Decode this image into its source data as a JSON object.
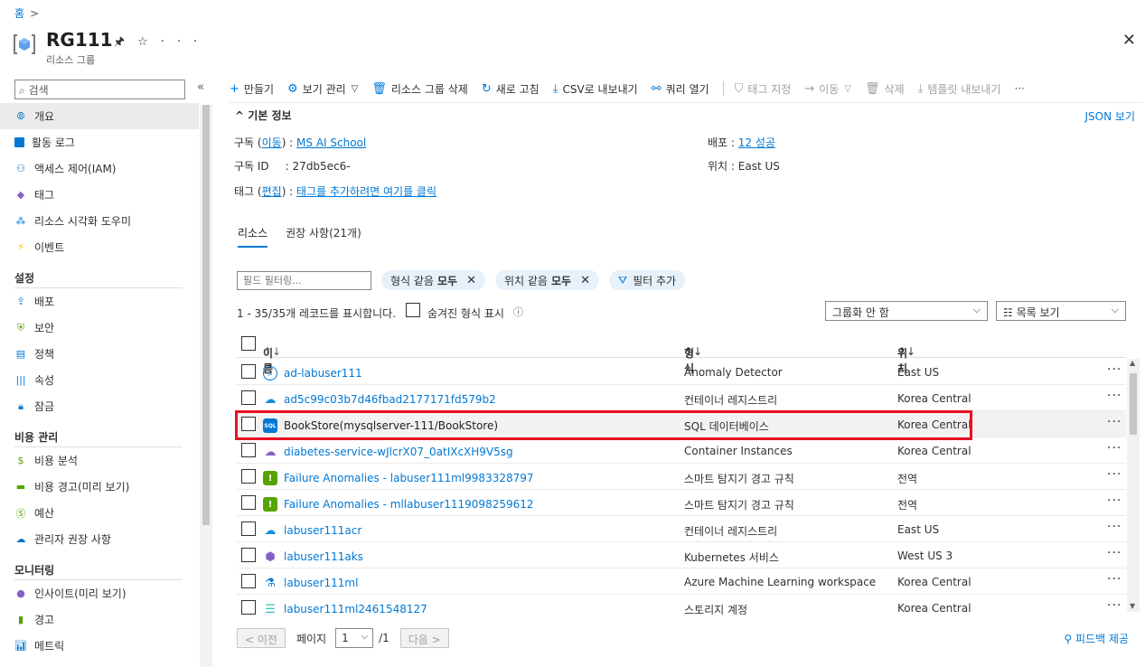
{
  "breadcrumb": {
    "home": "홈"
  },
  "header": {
    "title": "RG111",
    "subtitle": "리소스 그룹"
  },
  "sidebar": {
    "search_placeholder": "검색",
    "items": [
      {
        "label": "개요",
        "icon": "overview-icon"
      },
      {
        "label": "활동 로그",
        "icon": "log-icon"
      },
      {
        "label": "액세스 제어(IAM)",
        "icon": "people-icon"
      },
      {
        "label": "태그",
        "icon": "tag-icon"
      },
      {
        "label": "리소스 시각화 도우미",
        "icon": "visualizer-icon"
      },
      {
        "label": "이벤트",
        "icon": "lightning-icon"
      }
    ],
    "section_settings": "설정",
    "settings_items": [
      {
        "label": "배포",
        "icon": "deploy-icon"
      },
      {
        "label": "보안",
        "icon": "shield-icon"
      },
      {
        "label": "정책",
        "icon": "policy-icon"
      },
      {
        "label": "속성",
        "icon": "properties-icon"
      },
      {
        "label": "잠금",
        "icon": "lock-icon"
      }
    ],
    "section_cost": "비용 관리",
    "cost_items": [
      {
        "label": "비용 분석",
        "icon": "cost-analysis-icon"
      },
      {
        "label": "비용 경고(미리 보기)",
        "icon": "cost-alert-icon"
      },
      {
        "label": "예산",
        "icon": "budget-icon"
      },
      {
        "label": "관리자 권장 사항",
        "icon": "advisor-icon"
      }
    ],
    "section_monitoring": "모니터링",
    "monitoring_items": [
      {
        "label": "인사이트(미리 보기)",
        "icon": "insights-icon"
      },
      {
        "label": "경고",
        "icon": "alerts-icon"
      },
      {
        "label": "메트릭",
        "icon": "metrics-icon"
      }
    ]
  },
  "toolbar": {
    "create": "만들기",
    "manage_view": "보기 관리",
    "delete_rg": "리소스 그룹 삭제",
    "refresh": "새로 고침",
    "export_csv": "CSV로 내보내기",
    "open_query": "쿼리 열기",
    "assign_tags": "태그 지정",
    "move": "이동",
    "delete": "삭제",
    "export_template": "템플릿 내보내기"
  },
  "essentials": {
    "header": "기본 정보",
    "json_view": "JSON 보기",
    "subscription_label": "구독",
    "subscription_move": "이동",
    "subscription_value": "MS AI School",
    "subscription_id_label": "구독 ID",
    "subscription_id_value": "27db5ec6-",
    "tags_label": "태그",
    "tags_edit": "편집",
    "tags_value": "태그를 추가하려면 여기를 클릭",
    "deployments_label": "배포",
    "deployments_value": "12 성공",
    "location_label": "위치",
    "location_value": "East US"
  },
  "tabs": {
    "resources": "리소스",
    "recommendations": "권장 사항(21개)"
  },
  "filters": {
    "placeholder": "필드 필터링...",
    "type_prefix": "형식 같음",
    "type_value": "모두",
    "location_prefix": "위치 같음",
    "location_value": "모두",
    "add_filter": "필터 추가"
  },
  "records": {
    "summary": "1 - 35/35개 레코드를 표시합니다.",
    "show_hidden": "숨겨진 형식 표시",
    "grouping": "그룹화 안 함",
    "view_mode": "목록 보기"
  },
  "table": {
    "col_name": "이름",
    "col_type": "형식",
    "col_location": "위치",
    "rows": [
      {
        "name": "ad-labuser111",
        "type": "Anomaly Detector",
        "location": "East US",
        "icon": "anomaly-detector-icon"
      },
      {
        "name": "ad5c99c03b7d46fbad2177171fd579b2",
        "type": "컨테이너 레지스트리",
        "location": "Korea Central",
        "icon": "container-registry-icon"
      },
      {
        "name": "BookStore(mysqlserver-111/BookStore)",
        "type": "SQL 데이터베이스",
        "location": "Korea Central",
        "icon": "sql-database-icon"
      },
      {
        "name": "diabetes-service-wJlcrX07_0atIXcXH9V5sg",
        "type": "Container Instances",
        "location": "Korea Central",
        "icon": "container-instance-icon"
      },
      {
        "name": "Failure Anomalies - labuser111ml9983328797",
        "type": "스마트 탐지기 경고 규칙",
        "location": "전역",
        "icon": "smart-detector-icon"
      },
      {
        "name": "Failure Anomalies - mllabuser1119098259612",
        "type": "스마트 탐지기 경고 규칙",
        "location": "전역",
        "icon": "smart-detector-icon"
      },
      {
        "name": "labuser111acr",
        "type": "컨테이너 레지스트리",
        "location": "East US",
        "icon": "container-registry-icon"
      },
      {
        "name": "labuser111aks",
        "type": "Kubernetes 서비스",
        "location": "West US 3",
        "icon": "kubernetes-icon"
      },
      {
        "name": "labuser111ml",
        "type": "Azure Machine Learning workspace",
        "location": "Korea Central",
        "icon": "machine-learning-icon"
      },
      {
        "name": "labuser111ml2461548127",
        "type": "스토리지 계정",
        "location": "Korea Central",
        "icon": "storage-account-icon"
      }
    ]
  },
  "pager": {
    "prev": "< 이전",
    "page_label": "페이지",
    "page_value": "1",
    "page_total": "/1",
    "next": "다음 >"
  },
  "feedback": "피드백 제공",
  "colors": {
    "accent": "#0078d4",
    "highlight_border": "#e81123"
  }
}
